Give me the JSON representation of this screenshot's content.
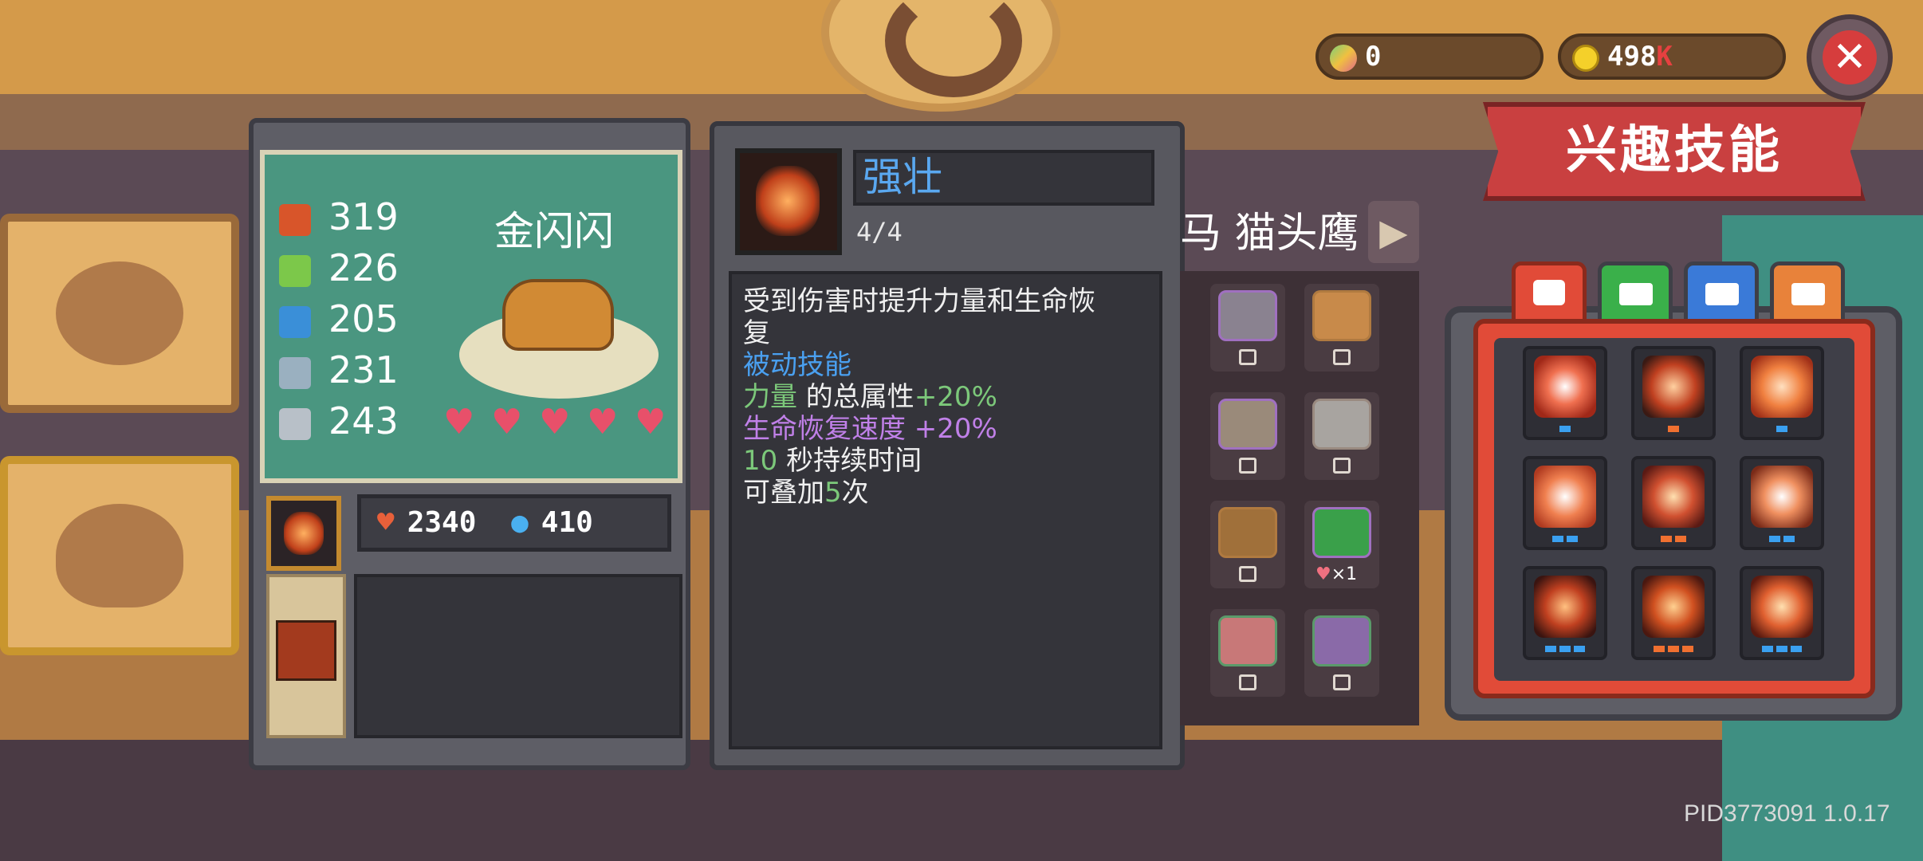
{
  "currency": {
    "gems": "0",
    "coins": "498",
    "coins_suffix": "K"
  },
  "banner": {
    "title": "兴趣技能"
  },
  "character": {
    "name": "金闪闪",
    "stats": [
      {
        "icon": "fist-icon",
        "value": "319"
      },
      {
        "icon": "feather-icon",
        "value": "226"
      },
      {
        "icon": "book-icon",
        "value": "205"
      },
      {
        "icon": "sword-icon",
        "value": "231"
      },
      {
        "icon": "shield-icon",
        "value": "243"
      }
    ],
    "hearts": 5,
    "hp": "2340",
    "mp": "410"
  },
  "skill_detail": {
    "name": "强壮",
    "level": "4/4",
    "description_1": "受到伤害时提升力量和生命恢",
    "description_2": "复",
    "type": "被动技能",
    "effect_1_name": "力量",
    "effect_1_text": " 的总属性",
    "effect_1_value": "+20%",
    "effect_2_name": "生命恢复速度",
    "effect_2_value": " +20%",
    "duration_value": "10",
    "duration_text": " 秒持续时间",
    "stack_prefix": "可叠加",
    "stack_value": "5",
    "stack_suffix": "次"
  },
  "pet_list": {
    "header": "马 猫头鹰",
    "special_count": "×1"
  },
  "colors": {
    "accent_blue": "#5aa8f0",
    "green": "#7cc87a",
    "purple": "#c080e8",
    "banner_red": "#c94040"
  },
  "version": "PID3773091 1.0.17"
}
